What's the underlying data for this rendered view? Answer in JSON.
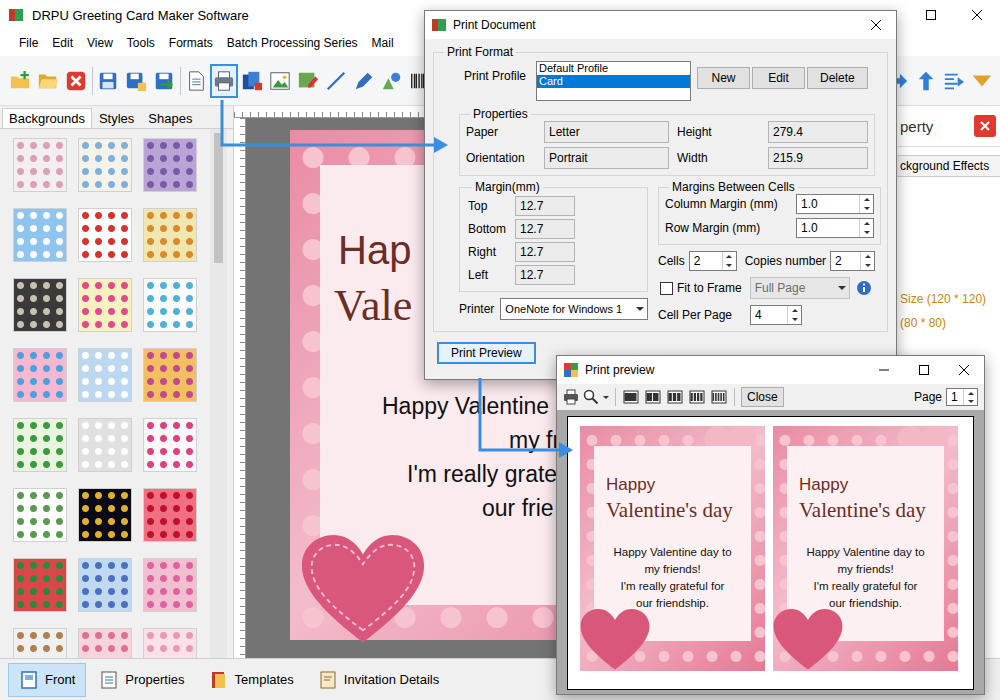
{
  "window": {
    "title": "DRPU Greeting Card Maker Software"
  },
  "menu": [
    "File",
    "Edit",
    "View",
    "Tools",
    "Formats",
    "Batch Processing Series",
    "Mail"
  ],
  "toolbar": {
    "left": [
      {
        "kind": "new",
        "selected": false
      },
      {
        "kind": "open",
        "selected": false
      },
      {
        "kind": "close",
        "selected": false
      },
      {
        "kind": "separator",
        "selected": false
      },
      {
        "kind": "save",
        "selected": false
      },
      {
        "kind": "save-as",
        "selected": false
      },
      {
        "kind": "export",
        "selected": false
      },
      {
        "kind": "separator",
        "selected": false
      },
      {
        "kind": "page",
        "selected": false
      },
      {
        "kind": "print",
        "selected": true
      },
      {
        "kind": "batch",
        "selected": false
      },
      {
        "kind": "image",
        "selected": false
      },
      {
        "kind": "picture",
        "selected": false
      },
      {
        "kind": "line",
        "selected": false
      },
      {
        "kind": "pen",
        "selected": false
      },
      {
        "kind": "shape",
        "selected": false
      },
      {
        "kind": "barcode",
        "selected": false
      },
      {
        "kind": "wordart",
        "selected": false
      }
    ],
    "right": [
      {
        "kind": "arrow-right",
        "selected": false
      },
      {
        "kind": "arrow-up",
        "selected": false
      },
      {
        "kind": "align",
        "selected": false
      },
      {
        "kind": "arrow-down",
        "selected": false
      }
    ]
  },
  "left_panel": {
    "tabs": [
      {
        "label": "Backgrounds",
        "selected": true
      },
      {
        "label": "Styles",
        "selected": false
      },
      {
        "label": "Shapes",
        "selected": false
      }
    ],
    "thumbnails": [
      {
        "color": "#f3eef0",
        "accent": "#d9a0b8"
      },
      {
        "color": "#f4f2ea",
        "accent": "#7fb0d8"
      },
      {
        "color": "#b9a4d6",
        "accent": "#7a5aa8"
      },
      {
        "color": "#8ec4ee",
        "accent": "#ffffff"
      },
      {
        "color": "#ffffff",
        "accent": "#d8322c"
      },
      {
        "color": "#f0e7b0",
        "accent": "#d98a2a"
      },
      {
        "color": "#3a3a3a",
        "accent": "#c9c0b0"
      },
      {
        "color": "#f7f0c0",
        "accent": "#e24a8a"
      },
      {
        "color": "#fafafa",
        "accent": "#4fb0d8"
      },
      {
        "color": "#f5b8d0",
        "accent": "#4aa0e0"
      },
      {
        "color": "#bcd8f0",
        "accent": "#ffffff"
      },
      {
        "color": "#f2c060",
        "accent": "#c04a8a"
      },
      {
        "color": "#e8f4e0",
        "accent": "#3a9a40"
      },
      {
        "color": "#e0e0e0",
        "accent": "#ffffff"
      },
      {
        "color": "#f8f8f8",
        "accent": "#e04080"
      },
      {
        "color": "#ffffff",
        "accent": "#5a9a50"
      },
      {
        "color": "#0a0a14",
        "accent": "#e0b030"
      },
      {
        "color": "#f07080",
        "accent": "#c01030"
      },
      {
        "color": "#d84848",
        "accent": "#2a8a3a"
      },
      {
        "color": "#c0d8f0",
        "accent": "#4a70c0"
      },
      {
        "color": "#f0c0d0",
        "accent": "#e060a0"
      },
      {
        "color": "#f0f0f0",
        "accent": "#b08050"
      },
      {
        "color": "#f6d4dc",
        "accent": "#e07090"
      },
      {
        "color": "#fbe0ea",
        "accent": "#e89ab0"
      }
    ]
  },
  "card": {
    "title": "Hap",
    "subtitle": "Vale",
    "lines": [
      "Happy Valentine",
      "my fr",
      "I'm really grate",
      "our frie"
    ]
  },
  "properties_panel": {
    "title": "perty",
    "tab": "ckground Effects",
    "sizes": [
      "Size (120 * 120)",
      "(80 * 80)"
    ]
  },
  "bottom_tabs": [
    {
      "label": "Front",
      "kind": "front",
      "selected": true
    },
    {
      "label": "Properties",
      "kind": "properties",
      "selected": false
    },
    {
      "label": "Templates",
      "kind": "templates",
      "selected": false
    },
    {
      "label": "Invitation Details",
      "kind": "invitation",
      "selected": false
    }
  ],
  "print_dialog": {
    "title": "Print Document",
    "format_label": "Print Format",
    "profile_label": "Print Profile",
    "profiles": [
      {
        "label": "Default Profile",
        "selected": false
      },
      {
        "label": "Card",
        "selected": true
      }
    ],
    "profile_buttons": [
      "New",
      "Edit",
      "Delete"
    ],
    "properties": {
      "label": "Properties",
      "fields": [
        {
          "label": "Paper",
          "value": "Letter"
        },
        {
          "label": "Height",
          "value": "279.4"
        },
        {
          "label": "Orientation",
          "value": "Portrait"
        },
        {
          "label": "Width",
          "value": "215.9"
        }
      ]
    },
    "margins": {
      "label": "Margin(mm)",
      "fields": [
        {
          "label": "Top",
          "value": "12.7"
        },
        {
          "label": "Bottom",
          "value": "12.7"
        },
        {
          "label": "Right",
          "value": "12.7"
        },
        {
          "label": "Left",
          "value": "12.7"
        }
      ]
    },
    "cell_margins": {
      "label": "Margins Between Cells",
      "fields": [
        {
          "label": "Column Margin (mm)",
          "value": "1.0"
        },
        {
          "label": "Row Margin (mm)",
          "value": "1.0"
        }
      ]
    },
    "cells": {
      "label": "Cells",
      "value": "2"
    },
    "copies": {
      "label": "Copies number",
      "value": "2"
    },
    "fit_to_frame": {
      "label": "Fit to Frame",
      "checked": false
    },
    "fit_mode": {
      "value": "Full Page",
      "disabled": true
    },
    "cell_per_page": {
      "label": "Cell Per Page",
      "value": "4"
    },
    "printer": {
      "label": "Printer",
      "value": "OneNote for Windows 1"
    },
    "preview_button": {
      "label": "Print Preview",
      "focused": true
    }
  },
  "print_preview": {
    "title": "Print preview",
    "close_label": "Close",
    "page_label": "Page",
    "page": "1",
    "pages": [
      {
        "title": "Happy",
        "subtitle": "Valentine's day",
        "lines": [
          "Happy Valentine day to",
          "my friends!",
          "I'm really grateful for",
          "our friendship."
        ]
      },
      {
        "title": "Happy",
        "subtitle": "Valentine's day",
        "lines": [
          "Happy Valentine day to",
          "my friends!",
          "I'm really grateful for",
          "our friendship."
        ]
      }
    ]
  }
}
